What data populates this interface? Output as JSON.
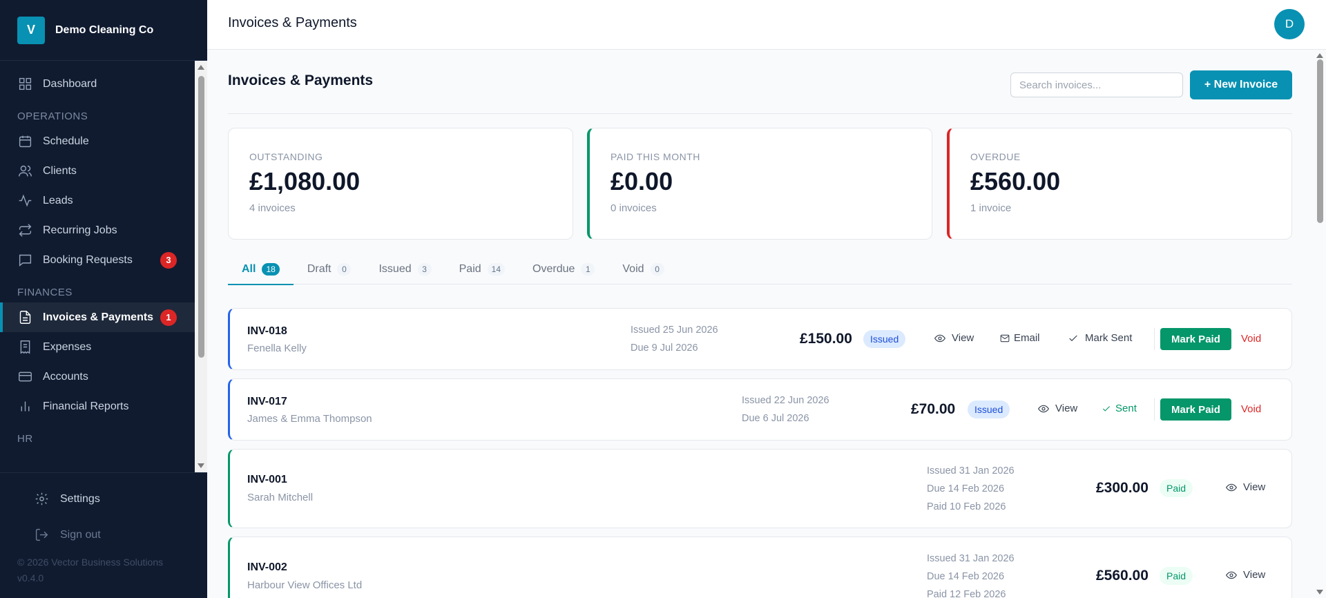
{
  "brand": {
    "logo_letter": "V",
    "name": "Demo Cleaning Co"
  },
  "nav": {
    "dashboard": "Dashboard",
    "section_operations": "OPERATIONS",
    "schedule": "Schedule",
    "clients": "Clients",
    "leads": "Leads",
    "recurring_jobs": "Recurring Jobs",
    "booking_requests": "Booking Requests",
    "booking_requests_badge": "3",
    "section_finances": "FINANCES",
    "invoices_payments": "Invoices & Payments",
    "invoices_payments_badge": "1",
    "expenses": "Expenses",
    "accounts": "Accounts",
    "financial_reports": "Financial Reports",
    "section_hr": "HR",
    "settings": "Settings",
    "sign_out": "Sign out",
    "copyright": "© 2026 Vector Business Solutions",
    "version": "v0.4.0"
  },
  "header": {
    "title": "Invoices & Payments",
    "avatar_initial": "D"
  },
  "page": {
    "title": "Invoices & Payments",
    "search_placeholder": "Search invoices...",
    "new_invoice_label": "+ New Invoice"
  },
  "summary": {
    "outstanding": {
      "label": "OUTSTANDING",
      "value": "£1,080.00",
      "sub": "4 invoices"
    },
    "paid_this_month": {
      "label": "PAID THIS MONTH",
      "value": "£0.00",
      "sub": "0 invoices"
    },
    "overdue": {
      "label": "OVERDUE",
      "value": "£560.00",
      "sub": "1 invoice"
    }
  },
  "tabs": [
    {
      "label": "All",
      "count": "18"
    },
    {
      "label": "Draft",
      "count": "0"
    },
    {
      "label": "Issued",
      "count": "3"
    },
    {
      "label": "Paid",
      "count": "14"
    },
    {
      "label": "Overdue",
      "count": "1"
    },
    {
      "label": "Void",
      "count": "0"
    }
  ],
  "actions": {
    "view": "View",
    "email": "Email",
    "mark_sent": "Mark Sent",
    "sent": "Sent",
    "mark_paid": "Mark Paid",
    "void": "Void"
  },
  "invoices": [
    {
      "id": "INV-018",
      "client": "Fenella Kelly",
      "issued": "Issued 25 Jun 2026",
      "due": "Due 9 Jul 2026",
      "amount": "£150.00",
      "status": "Issued"
    },
    {
      "id": "INV-017",
      "client": "James & Emma Thompson",
      "issued": "Issued 22 Jun 2026",
      "due": "Due 6 Jul 2026",
      "amount": "£70.00",
      "status": "Issued"
    },
    {
      "id": "INV-001",
      "client": "Sarah Mitchell",
      "issued": "Issued 31 Jan 2026",
      "due": "Due 14 Feb 2026",
      "paid": "Paid 10 Feb 2026",
      "amount": "£300.00",
      "status": "Paid"
    },
    {
      "id": "INV-002",
      "client": "Harbour View Offices Ltd",
      "issued": "Issued 31 Jan 2026",
      "due": "Due 14 Feb 2026",
      "paid": "Paid 12 Feb 2026",
      "amount": "£560.00",
      "status": "Paid"
    }
  ],
  "colors": {
    "accent": "#0891b2",
    "sidebar_bg": "#101b30",
    "issued": "#2563eb",
    "paid": "#059669",
    "danger": "#dc2626"
  }
}
